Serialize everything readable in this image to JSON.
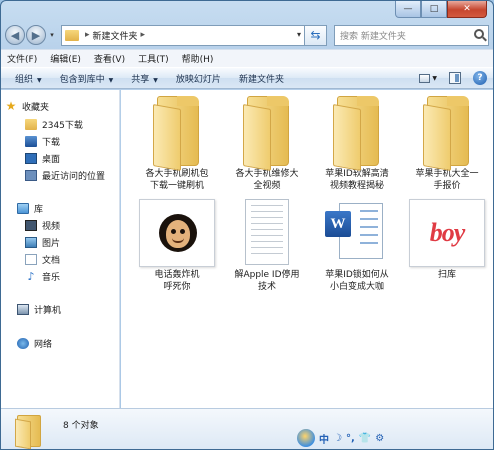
{
  "window": {
    "controls": {
      "minimize": "—",
      "maximize": "□",
      "close": "✕"
    }
  },
  "address": {
    "breadcrumb": "新建文件夹",
    "separator_before": "▸",
    "separator_after": "▸",
    "search_placeholder": "搜索 新建文件夹"
  },
  "menubar": [
    "文件(F)",
    "编辑(E)",
    "查看(V)",
    "工具(T)",
    "帮助(H)"
  ],
  "commandbar": {
    "organize": "组织",
    "include_library": "包含到库中",
    "share": "共享",
    "slideshow": "放映幻灯片",
    "new_folder": "新建文件夹"
  },
  "nav": {
    "favorites": "收藏夹",
    "favorites_items": [
      "2345下载",
      "下载",
      "桌面",
      "最近访问的位置"
    ],
    "libraries": "库",
    "library_items": [
      "视频",
      "图片",
      "文档",
      "音乐"
    ],
    "computer": "计算机",
    "network": "网络"
  },
  "files": [
    {
      "name_line1": "各大手机刷机包",
      "name_line2": "下载一键刷机",
      "type": "folder"
    },
    {
      "name_line1": "各大手机维修大",
      "name_line2": "全视频",
      "type": "folder"
    },
    {
      "name_line1": "苹果ID软解高清",
      "name_line2": "视频教程揭秘",
      "type": "folder"
    },
    {
      "name_line1": "苹果手机大全一",
      "name_line2": "手报价",
      "type": "folder"
    },
    {
      "name_line1": "电话轰炸机",
      "name_line2": "呼死你",
      "type": "image"
    },
    {
      "name_line1": "解Apple ID停用",
      "name_line2": "技术",
      "type": "text"
    },
    {
      "name_line1": "苹果ID锁如何从",
      "name_line2": "小白变成大咖",
      "type": "word"
    },
    {
      "name_line1": "扫库",
      "name_line2": "",
      "type": "image-boy",
      "thumb_text": "boy"
    }
  ],
  "details": {
    "count": "8 个对象"
  },
  "ime": {
    "label": "中",
    "symbols": [
      "☽",
      "°,",
      "👕",
      "⚙"
    ]
  },
  "colors": {
    "accent": "#2c6fbd",
    "folder": "#e5bb52",
    "close": "#c6462f",
    "boy": "#e03b44"
  }
}
